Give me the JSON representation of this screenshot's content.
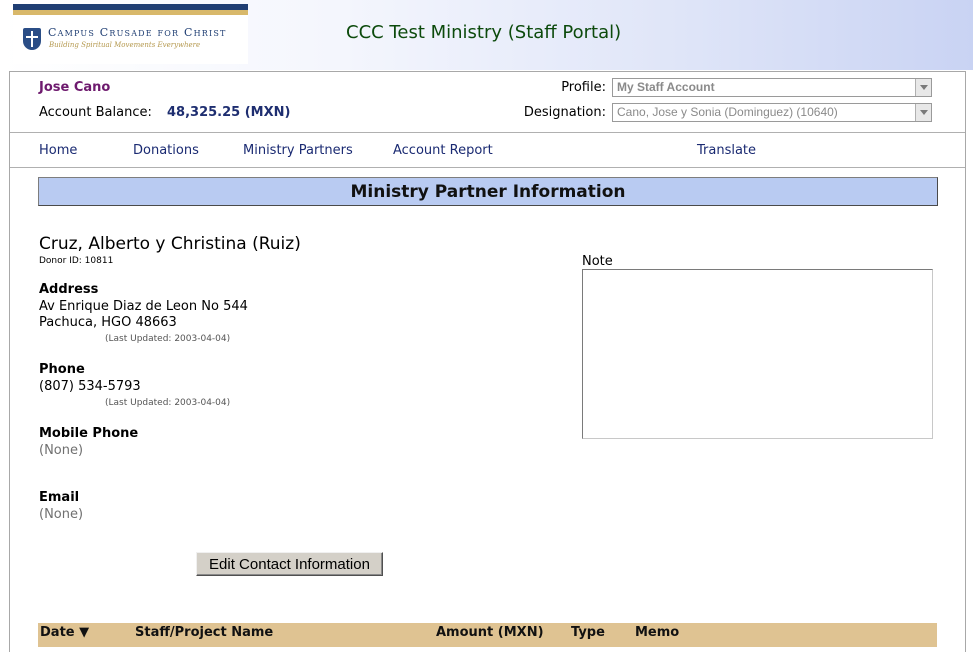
{
  "logo": {
    "name": "Campus Crusade for Christ",
    "tagline": "Building Spiritual Movements Everywhere"
  },
  "portal_title": "CCC Test Ministry (Staff Portal)",
  "account": {
    "user_name": "Jose Cano",
    "balance_label": "Account Balance:",
    "balance_value": "48,325.25 (MXN)",
    "profile_label": "Profile:",
    "profile_value": "My Staff Account",
    "designation_label": "Designation:",
    "designation_value": "Cano, Jose y Sonia (Dominguez) (10640)"
  },
  "nav": {
    "home": "Home",
    "donations": "Donations",
    "ministry_partners": "Ministry Partners",
    "account_report": "Account Report",
    "translate": "Translate"
  },
  "section_title": "Ministry Partner Information",
  "partner": {
    "name": "Cruz, Alberto y Christina (Ruiz)",
    "donor_id": "Donor ID: 10811",
    "address_label": "Address",
    "address_line1": "Av Enrique Diaz de Leon No 544",
    "address_line2": "Pachuca, HGO 48663",
    "address_updated": "(Last Updated: 2003-04-04)",
    "phone_label": "Phone",
    "phone_value": "(807) 534-5793",
    "phone_updated": "(Last Updated: 2003-04-04)",
    "mobile_label": "Mobile Phone",
    "mobile_value": "(None)",
    "email_label": "Email",
    "email_value": "(None)"
  },
  "note": {
    "label": "Note",
    "value": ""
  },
  "edit_button": "Edit Contact Information",
  "table": {
    "headers": [
      "Date ▼",
      "Staff/Project Name",
      "Amount (MXN)",
      "Type",
      "Memo"
    ]
  },
  "colors": {
    "section_bar": "#b9cbf2",
    "table_header": "#dfc392",
    "user_name": "#6e1a6e",
    "nav_link": "#1a2a72",
    "portal_title": "#0c4a0c"
  }
}
